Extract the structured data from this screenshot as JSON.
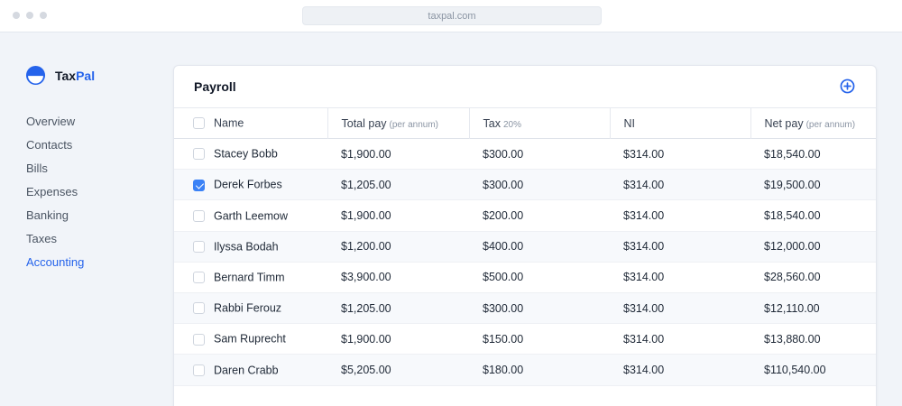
{
  "browser": {
    "url": "taxpal.com"
  },
  "brand": {
    "name_part1": "Tax",
    "name_part2": "Pal"
  },
  "sidebar": {
    "items": [
      {
        "label": "Overview",
        "active": false
      },
      {
        "label": "Contacts",
        "active": false
      },
      {
        "label": "Bills",
        "active": false
      },
      {
        "label": "Expenses",
        "active": false
      },
      {
        "label": "Banking",
        "active": false
      },
      {
        "label": "Taxes",
        "active": false
      },
      {
        "label": "Accounting",
        "active": true
      }
    ]
  },
  "payroll": {
    "title": "Payroll",
    "add_icon": "plus-circle-icon",
    "columns": {
      "name": "Name",
      "total_pay": "Total pay",
      "total_pay_sub": "(per annum)",
      "tax": "Tax",
      "tax_sub": "20%",
      "ni": "NI",
      "net_pay": "Net pay",
      "net_pay_sub": "(per annum)"
    },
    "rows": [
      {
        "checked": false,
        "name": "Stacey Bobb",
        "total": "$1,900.00",
        "tax": "$300.00",
        "ni": "$314.00",
        "net": "$18,540.00"
      },
      {
        "checked": true,
        "name": "Derek Forbes",
        "total": "$1,205.00",
        "tax": "$300.00",
        "ni": "$314.00",
        "net": "$19,500.00"
      },
      {
        "checked": false,
        "name": "Garth Leemow",
        "total": "$1,900.00",
        "tax": "$200.00",
        "ni": "$314.00",
        "net": "$18,540.00"
      },
      {
        "checked": false,
        "name": "Ilyssa Bodah",
        "total": "$1,200.00",
        "tax": "$400.00",
        "ni": "$314.00",
        "net": "$12,000.00"
      },
      {
        "checked": false,
        "name": "Bernard Timm",
        "total": "$3,900.00",
        "tax": "$500.00",
        "ni": "$314.00",
        "net": "$28,560.00"
      },
      {
        "checked": false,
        "name": "Rabbi Ferouz",
        "total": "$1,205.00",
        "tax": "$300.00",
        "ni": "$314.00",
        "net": "$12,110.00"
      },
      {
        "checked": false,
        "name": "Sam Ruprecht",
        "total": "$1,900.00",
        "tax": "$150.00",
        "ni": "$314.00",
        "net": "$13,880.00"
      },
      {
        "checked": false,
        "name": "Daren Crabb",
        "total": "$5,205.00",
        "tax": "$180.00",
        "ni": "$314.00",
        "net": "$110,540.00"
      }
    ]
  },
  "colors": {
    "accent": "#2563eb",
    "checkbox_checked": "#3b82f6"
  }
}
